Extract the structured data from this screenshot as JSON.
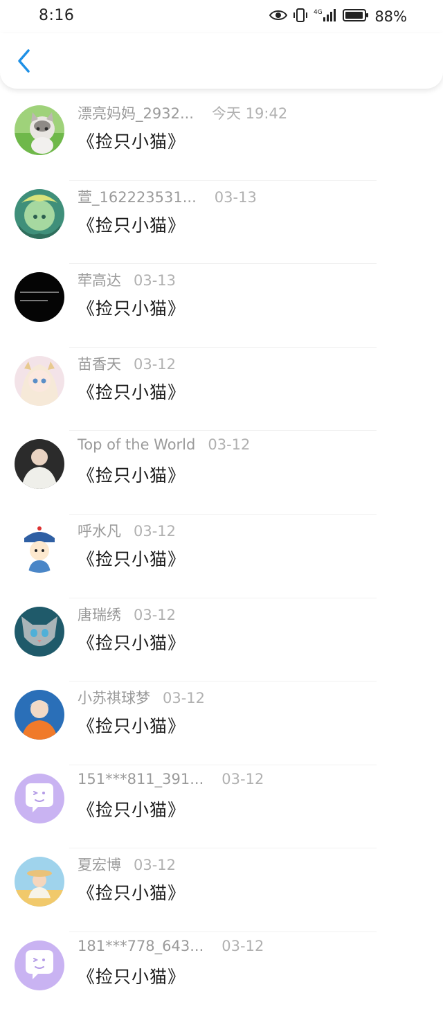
{
  "status_bar": {
    "time": "8:16",
    "network": "4G",
    "battery_percent": "88%",
    "icons": [
      "eye-icon",
      "vibrate-icon",
      "signal-icon",
      "battery-icon"
    ]
  },
  "header": {
    "back_icon": "chevron-left-icon",
    "accent_color": "#1e90e6"
  },
  "messages": [
    {
      "name": "漂亮妈妈_2932...",
      "date": "今天 19:42",
      "text": "《捡只小猫》",
      "avatar": "kitten-photo"
    },
    {
      "name": "萱_162223531...",
      "date": "03-13",
      "text": "《捡只小猫》",
      "avatar": "anime-green-photo"
    },
    {
      "name": "荦高达",
      "date": "03-13",
      "text": "《捡只小猫》",
      "avatar": "black-text-image"
    },
    {
      "name": "苗香天",
      "date": "03-12",
      "text": "《捡只小猫》",
      "avatar": "anime-girl-photo"
    },
    {
      "name": "Top of the World",
      "date": "03-12",
      "text": "《捡只小猫》",
      "avatar": "person-white-hoodie-photo"
    },
    {
      "name": "呼水凡",
      "date": "03-12",
      "text": "《捡只小猫》",
      "avatar": "cartoon-qing-official"
    },
    {
      "name": "唐瑞绣",
      "date": "03-12",
      "text": "《捡只小猫》",
      "avatar": "cat-face-photo"
    },
    {
      "name": "小苏祺球梦",
      "date": "03-12",
      "text": "《捡只小猫》",
      "avatar": "person-orange-shirt-photo"
    },
    {
      "name": "151***811_391...",
      "date": "03-12",
      "text": "《捡只小猫》",
      "avatar": "default-chat-bubble-avatar"
    },
    {
      "name": "夏宏博",
      "date": "03-12",
      "text": "《捡只小猫》",
      "avatar": "beach-girl-photo"
    },
    {
      "name": "181***778_643...",
      "date": "03-12",
      "text": "《捡只小猫》",
      "avatar": "default-chat-bubble-avatar"
    }
  ]
}
